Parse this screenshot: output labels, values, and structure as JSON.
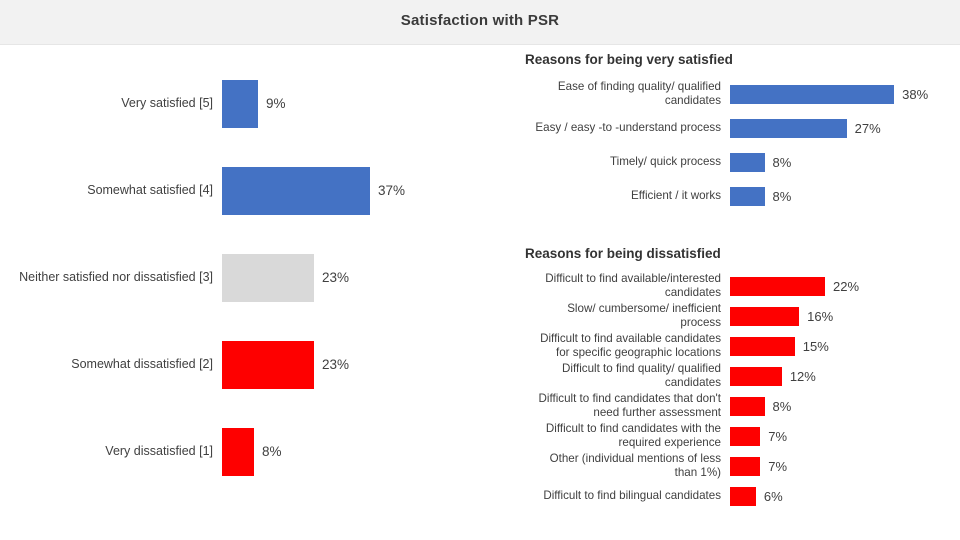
{
  "header": {
    "title": "Satisfaction with PSR"
  },
  "colors": {
    "blue": "#4472c4",
    "red": "#fe0000",
    "gray": "#d9d9d9",
    "header_band": "#f2f2f2",
    "text": "#404040"
  },
  "chart_data": [
    {
      "id": "satisfaction-scale",
      "type": "bar",
      "orientation": "horizontal",
      "title": "",
      "xlabel": "",
      "ylabel": "",
      "xlim": [
        0,
        40
      ],
      "grid": false,
      "legend": "none",
      "categories": [
        "Very satisfied [5]",
        "Somewhat satisfied [4]",
        "Neither satisfied nor dissatisfied [3]",
        "Somewhat dissatisfied [2]",
        "Very dissatisfied [1]"
      ],
      "values": [
        9,
        37,
        23,
        23,
        8
      ],
      "value_labels": [
        "9%",
        "37%",
        "23%",
        "23%",
        "8%"
      ],
      "bar_colors": [
        "#4472c4",
        "#4472c4",
        "#d9d9d9",
        "#fe0000",
        "#fe0000"
      ]
    },
    {
      "id": "reasons-very-satisfied",
      "type": "bar",
      "orientation": "horizontal",
      "title": "Reasons for being very satisfied",
      "xlabel": "",
      "ylabel": "",
      "xlim": [
        0,
        40
      ],
      "grid": false,
      "legend": "none",
      "categories": [
        "Ease of finding quality/ qualified candidates",
        "Easy / easy -to -understand process",
        "Timely/ quick process",
        "Efficient / it works"
      ],
      "values": [
        38,
        27,
        8,
        8
      ],
      "value_labels": [
        "38%",
        "27%",
        "8%",
        "8%"
      ],
      "bar_colors": [
        "#4472c4",
        "#4472c4",
        "#4472c4",
        "#4472c4"
      ]
    },
    {
      "id": "reasons-dissatisfied",
      "type": "bar",
      "orientation": "horizontal",
      "title": "Reasons for being dissatisfied",
      "xlabel": "",
      "ylabel": "",
      "xlim": [
        0,
        40
      ],
      "grid": false,
      "legend": "none",
      "categories": [
        "Difficult to find available/interested candidates",
        "Slow/ cumbersome/ inefficient process",
        "Difficult to find available candidates for specific geographic locations",
        "Difficult to find quality/ qualified candidates",
        "Difficult to find candidates that don't need further assessment",
        "Difficult to find candidates with the required experience",
        "Other (individual mentions of less than 1%)",
        "Difficult to find bilingual candidates"
      ],
      "values": [
        22,
        16,
        15,
        12,
        8,
        7,
        7,
        6
      ],
      "value_labels": [
        "22%",
        "16%",
        "15%",
        "12%",
        "8%",
        "7%",
        "7%",
        "6%"
      ],
      "bar_colors": [
        "#fe0000",
        "#fe0000",
        "#fe0000",
        "#fe0000",
        "#fe0000",
        "#fe0000",
        "#fe0000",
        "#fe0000"
      ]
    }
  ]
}
